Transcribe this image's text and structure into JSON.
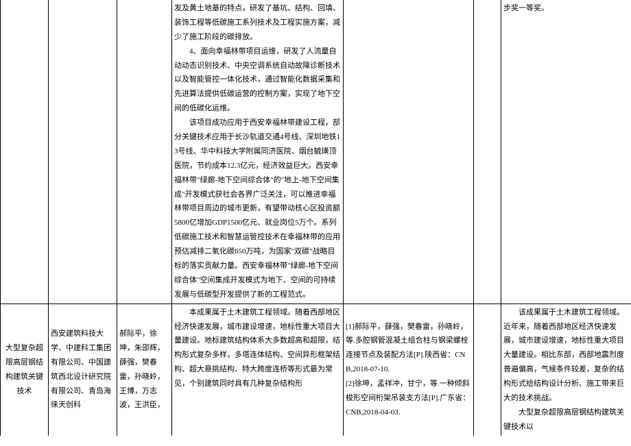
{
  "row1": {
    "col4_p1": "发及黄土地基的特点，研发了基坑、结构、回填、装饰工程等低碳施工系列技术及工程实施方案，减少了施工阶段的碳排放。",
    "col4_p2": "4、面向幸福林带项目运维，研发了人流量自动动态识别技术、中央空调系统自动故障诊断技术以及智能管控一体化技术，通过智能化数据采集和先进算法提供低碳运营的控制方案，实现了地下空间的低碳化运维。",
    "col4_p3": "该项目成功应用于西安幸福林带建设工程，部分关键技术应用于长沙轨道交通4号线、深圳地铁13号线、华中科技大学附属同济医院、烟台毓璜顶医院，节约成本12.3亿元，经济效益巨大。西安幸福林带\"绿廊-地下空间综合体\"的\"地上-地下空间集成\"开发模式获社会各界广泛关注，可以推进幸福林带项目周边的城市更新，有望带动核心区投资额5800亿增加GDP1500亿元、就业岗位5万个。系列低碳施工技术和智慧运管控技术在幸福林带的应用预估减排二氧化碳650万吨，为国家\"双碳\"战略目标的落实贡献力量。西安幸福林带\"绿廊-地下空间综合体\"空间集成开发模式为地下、空间的可持续发展与低碳型开发提供了新的工程范式。",
    "col7": "步奖一等奖。"
  },
  "row2": {
    "col1": "大型复杂超限高层钢结构建筑关键技术",
    "col2": "西安建筑科技大学、中建科工集团有限公司、中国建筑西北设计研究院有限公司、青岛海徕天创科",
    "col3": "郝际平，徐坤，朱邵辉，薛强，樊春雷，孙晓岭，王博，万志波，王洪臣，",
    "col4": "本成果属于土木建筑工程领域。随着西部地区经济快速发展，城市建设增速，地标性重大项目大量建设。地标建筑结构体系大多数超高和超限，结构形式复杂多样，多塔连体结构、空间异形框架结构、超大悬挑结构、特大跨度连桥等形式最为常见，个别建筑同时具有几种复杂结构形",
    "col5_r1": "[1]郝际平，薛强，樊春雷，孙晓岭，等.多腔钢管混凝土组合柱与钢梁螺栓连接节点及装配方法[P].陕西省：CNB,2018-07-10.",
    "col5_r2": "[2]徐坤，孟祥冲，甘宁，等.一种倾斜梭形空间桁架吊装支方法[P].广东省：CNB,2018-04-03.",
    "col7_p1": "该成果属于土木建筑工程领域。近年来，随着西部地区经济快速发展，城市建设增速，地标性重大项目大量建设。相比东部，西部地震烈度普遍偏高，气候条件较差，复杂的结构形式给结构设计分析、施工带来巨大的技术挑战。",
    "col7_p2": "大型复杂超限高层钢结构建筑关键技术以"
  }
}
